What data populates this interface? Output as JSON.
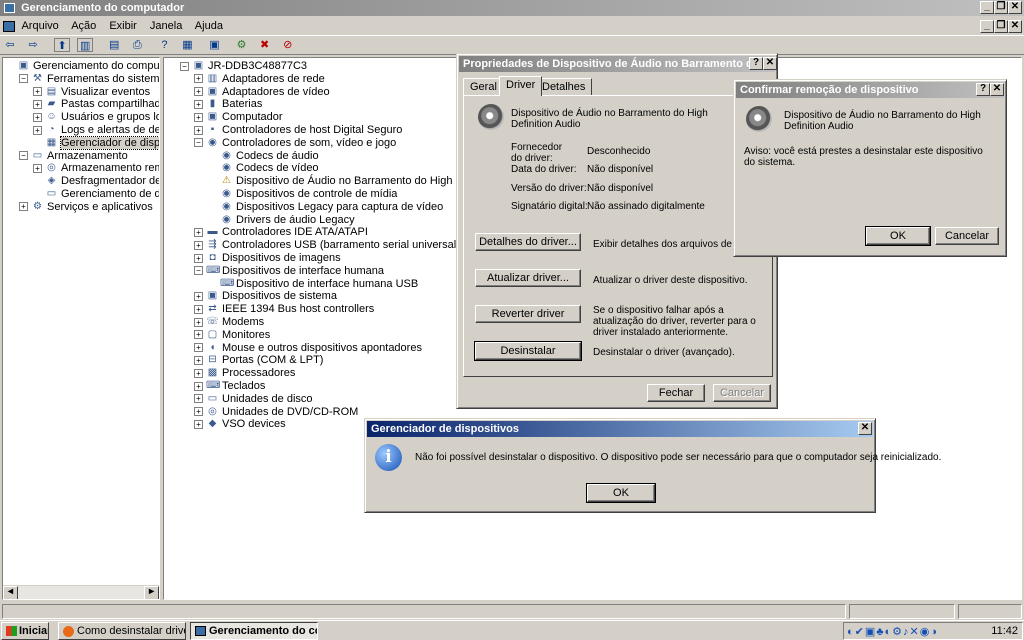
{
  "window": {
    "title": "Gerenciamento do computador"
  },
  "menu": [
    "Arquivo",
    "Ação",
    "Exibir",
    "Janela",
    "Ajuda"
  ],
  "left_tree": [
    {
      "label": "Gerenciamento do computador (loca",
      "level": 0,
      "pm": "",
      "icon": "computer-icon"
    },
    {
      "label": "Ferramentas do sistema",
      "level": 1,
      "pm": "-",
      "icon": "tools-icon"
    },
    {
      "label": "Visualizar eventos",
      "level": 2,
      "pm": "+",
      "icon": "event-viewer-icon"
    },
    {
      "label": "Pastas compartilhadas",
      "level": 2,
      "pm": "+",
      "icon": "shared-folder-icon"
    },
    {
      "label": "Usuários e grupos locais",
      "level": 2,
      "pm": "+",
      "icon": "users-icon"
    },
    {
      "label": "Logs e alertas de desempen",
      "level": 2,
      "pm": "+",
      "icon": "performance-icon"
    },
    {
      "label": "Gerenciador de dispositivos",
      "level": 2,
      "pm": "",
      "icon": "device-manager-icon",
      "selected": true
    },
    {
      "label": "Armazenamento",
      "level": 1,
      "pm": "-",
      "icon": "storage-icon"
    },
    {
      "label": "Armazenamento removível",
      "level": 2,
      "pm": "+",
      "icon": "removable-storage-icon"
    },
    {
      "label": "Desfragmentador de disco",
      "level": 2,
      "pm": "",
      "icon": "defrag-icon"
    },
    {
      "label": "Gerenciamento de disco",
      "level": 2,
      "pm": "",
      "icon": "disk-icon"
    },
    {
      "label": "Serviços e aplicativos",
      "level": 1,
      "pm": "+",
      "icon": "services-icon"
    }
  ],
  "right_tree": [
    {
      "label": "JR-DDB3C48877C3",
      "level": 0,
      "pm": "-",
      "icon": "computer-icon"
    },
    {
      "label": "Adaptadores de rede",
      "level": 1,
      "pm": "+",
      "icon": "network-icon"
    },
    {
      "label": "Adaptadores de vídeo",
      "level": 1,
      "pm": "+",
      "icon": "display-icon"
    },
    {
      "label": "Baterias",
      "level": 1,
      "pm": "+",
      "icon": "battery-icon"
    },
    {
      "label": "Computador",
      "level": 1,
      "pm": "+",
      "icon": "computer-icon"
    },
    {
      "label": "Controladores de host Digital Seguro",
      "level": 1,
      "pm": "+",
      "icon": "sd-host-icon"
    },
    {
      "label": "Controladores de som, vídeo e jogo",
      "level": 1,
      "pm": "-",
      "icon": "sound-icon"
    },
    {
      "label": "Codecs de áudio",
      "level": 2,
      "pm": "",
      "icon": "sound-icon"
    },
    {
      "label": "Codecs de vídeo",
      "level": 2,
      "pm": "",
      "icon": "sound-icon"
    },
    {
      "label": "Dispositivo de Áudio no Barramento do High Definition Audio",
      "level": 2,
      "pm": "",
      "icon": "warning-sound-icon"
    },
    {
      "label": "Dispositivos de controle de mídia",
      "level": 2,
      "pm": "",
      "icon": "sound-icon"
    },
    {
      "label": "Dispositivos Legacy para captura de vídeo",
      "level": 2,
      "pm": "",
      "icon": "sound-icon"
    },
    {
      "label": "Drivers de áudio Legacy",
      "level": 2,
      "pm": "",
      "icon": "sound-icon"
    },
    {
      "label": "Controladores IDE ATA/ATAPI",
      "level": 1,
      "pm": "+",
      "icon": "ide-icon"
    },
    {
      "label": "Controladores USB (barramento serial universal)",
      "level": 1,
      "pm": "+",
      "icon": "usb-icon"
    },
    {
      "label": "Dispositivos de imagens",
      "level": 1,
      "pm": "+",
      "icon": "camera-icon"
    },
    {
      "label": "Dispositivos de interface humana",
      "level": 1,
      "pm": "-",
      "icon": "hid-icon"
    },
    {
      "label": "Dispositivo de interface humana USB",
      "level": 2,
      "pm": "",
      "icon": "hid-icon"
    },
    {
      "label": "Dispositivos de sistema",
      "level": 1,
      "pm": "+",
      "icon": "system-icon"
    },
    {
      "label": "IEEE 1394 Bus host controllers",
      "level": 1,
      "pm": "+",
      "icon": "firewire-icon"
    },
    {
      "label": "Modems",
      "level": 1,
      "pm": "+",
      "icon": "modem-icon"
    },
    {
      "label": "Monitores",
      "level": 1,
      "pm": "+",
      "icon": "monitor-icon"
    },
    {
      "label": "Mouse e outros dispositivos apontadores",
      "level": 1,
      "pm": "+",
      "icon": "mouse-icon"
    },
    {
      "label": "Portas (COM & LPT)",
      "level": 1,
      "pm": "+",
      "icon": "port-icon"
    },
    {
      "label": "Processadores",
      "level": 1,
      "pm": "+",
      "icon": "cpu-icon"
    },
    {
      "label": "Teclados",
      "level": 1,
      "pm": "+",
      "icon": "keyboard-icon"
    },
    {
      "label": "Unidades de disco",
      "level": 1,
      "pm": "+",
      "icon": "disk-icon"
    },
    {
      "label": "Unidades de DVD/CD-ROM",
      "level": 1,
      "pm": "+",
      "icon": "dvd-icon"
    },
    {
      "label": "VSO devices",
      "level": 1,
      "pm": "+",
      "icon": "vso-icon"
    }
  ],
  "props_dialog": {
    "title": "Propriedades de Dispositivo de Áudio no Barramento do High ...",
    "tabs": [
      "Geral",
      "Driver",
      "Detalhes"
    ],
    "device_name": "Dispositivo de Áudio no Barramento do High Definition Audio",
    "fields": [
      {
        "label": "Fornecedor do driver:",
        "value": "Desconhecido"
      },
      {
        "label": "Data do driver:",
        "value": "Não disponível"
      },
      {
        "label": "Versão do driver:",
        "value": "Não disponível"
      },
      {
        "label": "Signatário digital:",
        "value": "Não assinado digitalmente"
      }
    ],
    "actions": [
      {
        "button": "Detalhes do driver...",
        "desc": "Exibir detalhes dos arquivos de driver."
      },
      {
        "button": "Atualizar driver...",
        "desc": "Atualizar o driver deste dispositivo."
      },
      {
        "button": "Reverter driver",
        "desc": "Se o dispositivo falhar após a atualização do driver, reverter para o driver instalado anteriormente."
      },
      {
        "button": "Desinstalar",
        "desc": "Desinstalar o driver (avançado)."
      }
    ],
    "close_label": "Fechar",
    "cancel_label": "Cancelar"
  },
  "confirm_dialog": {
    "title": "Confirmar remoção de dispositivo",
    "device_name": "Dispositivo de Áudio no Barramento do High Definition Audio",
    "warning": "Aviso: você está prestes a desinstalar este dispositivo do sistema.",
    "ok_label": "OK",
    "cancel_label": "Cancelar"
  },
  "error_dialog": {
    "title": "Gerenciador de dispositivos",
    "message": "Não foi possível desinstalar o dispositivo. O dispositivo pode ser necessário para que o computador seja reinicializado.",
    "ok_label": "OK"
  },
  "taskbar": {
    "start_label": "Iniciar",
    "tasks": [
      "Como desinstalar driver i...",
      "Gerenciamento do co..."
    ],
    "clock": "11:42"
  },
  "colors": {
    "active_title": "#0a246a",
    "inactive_title": "#808080",
    "selection": "#d4d0c8"
  }
}
